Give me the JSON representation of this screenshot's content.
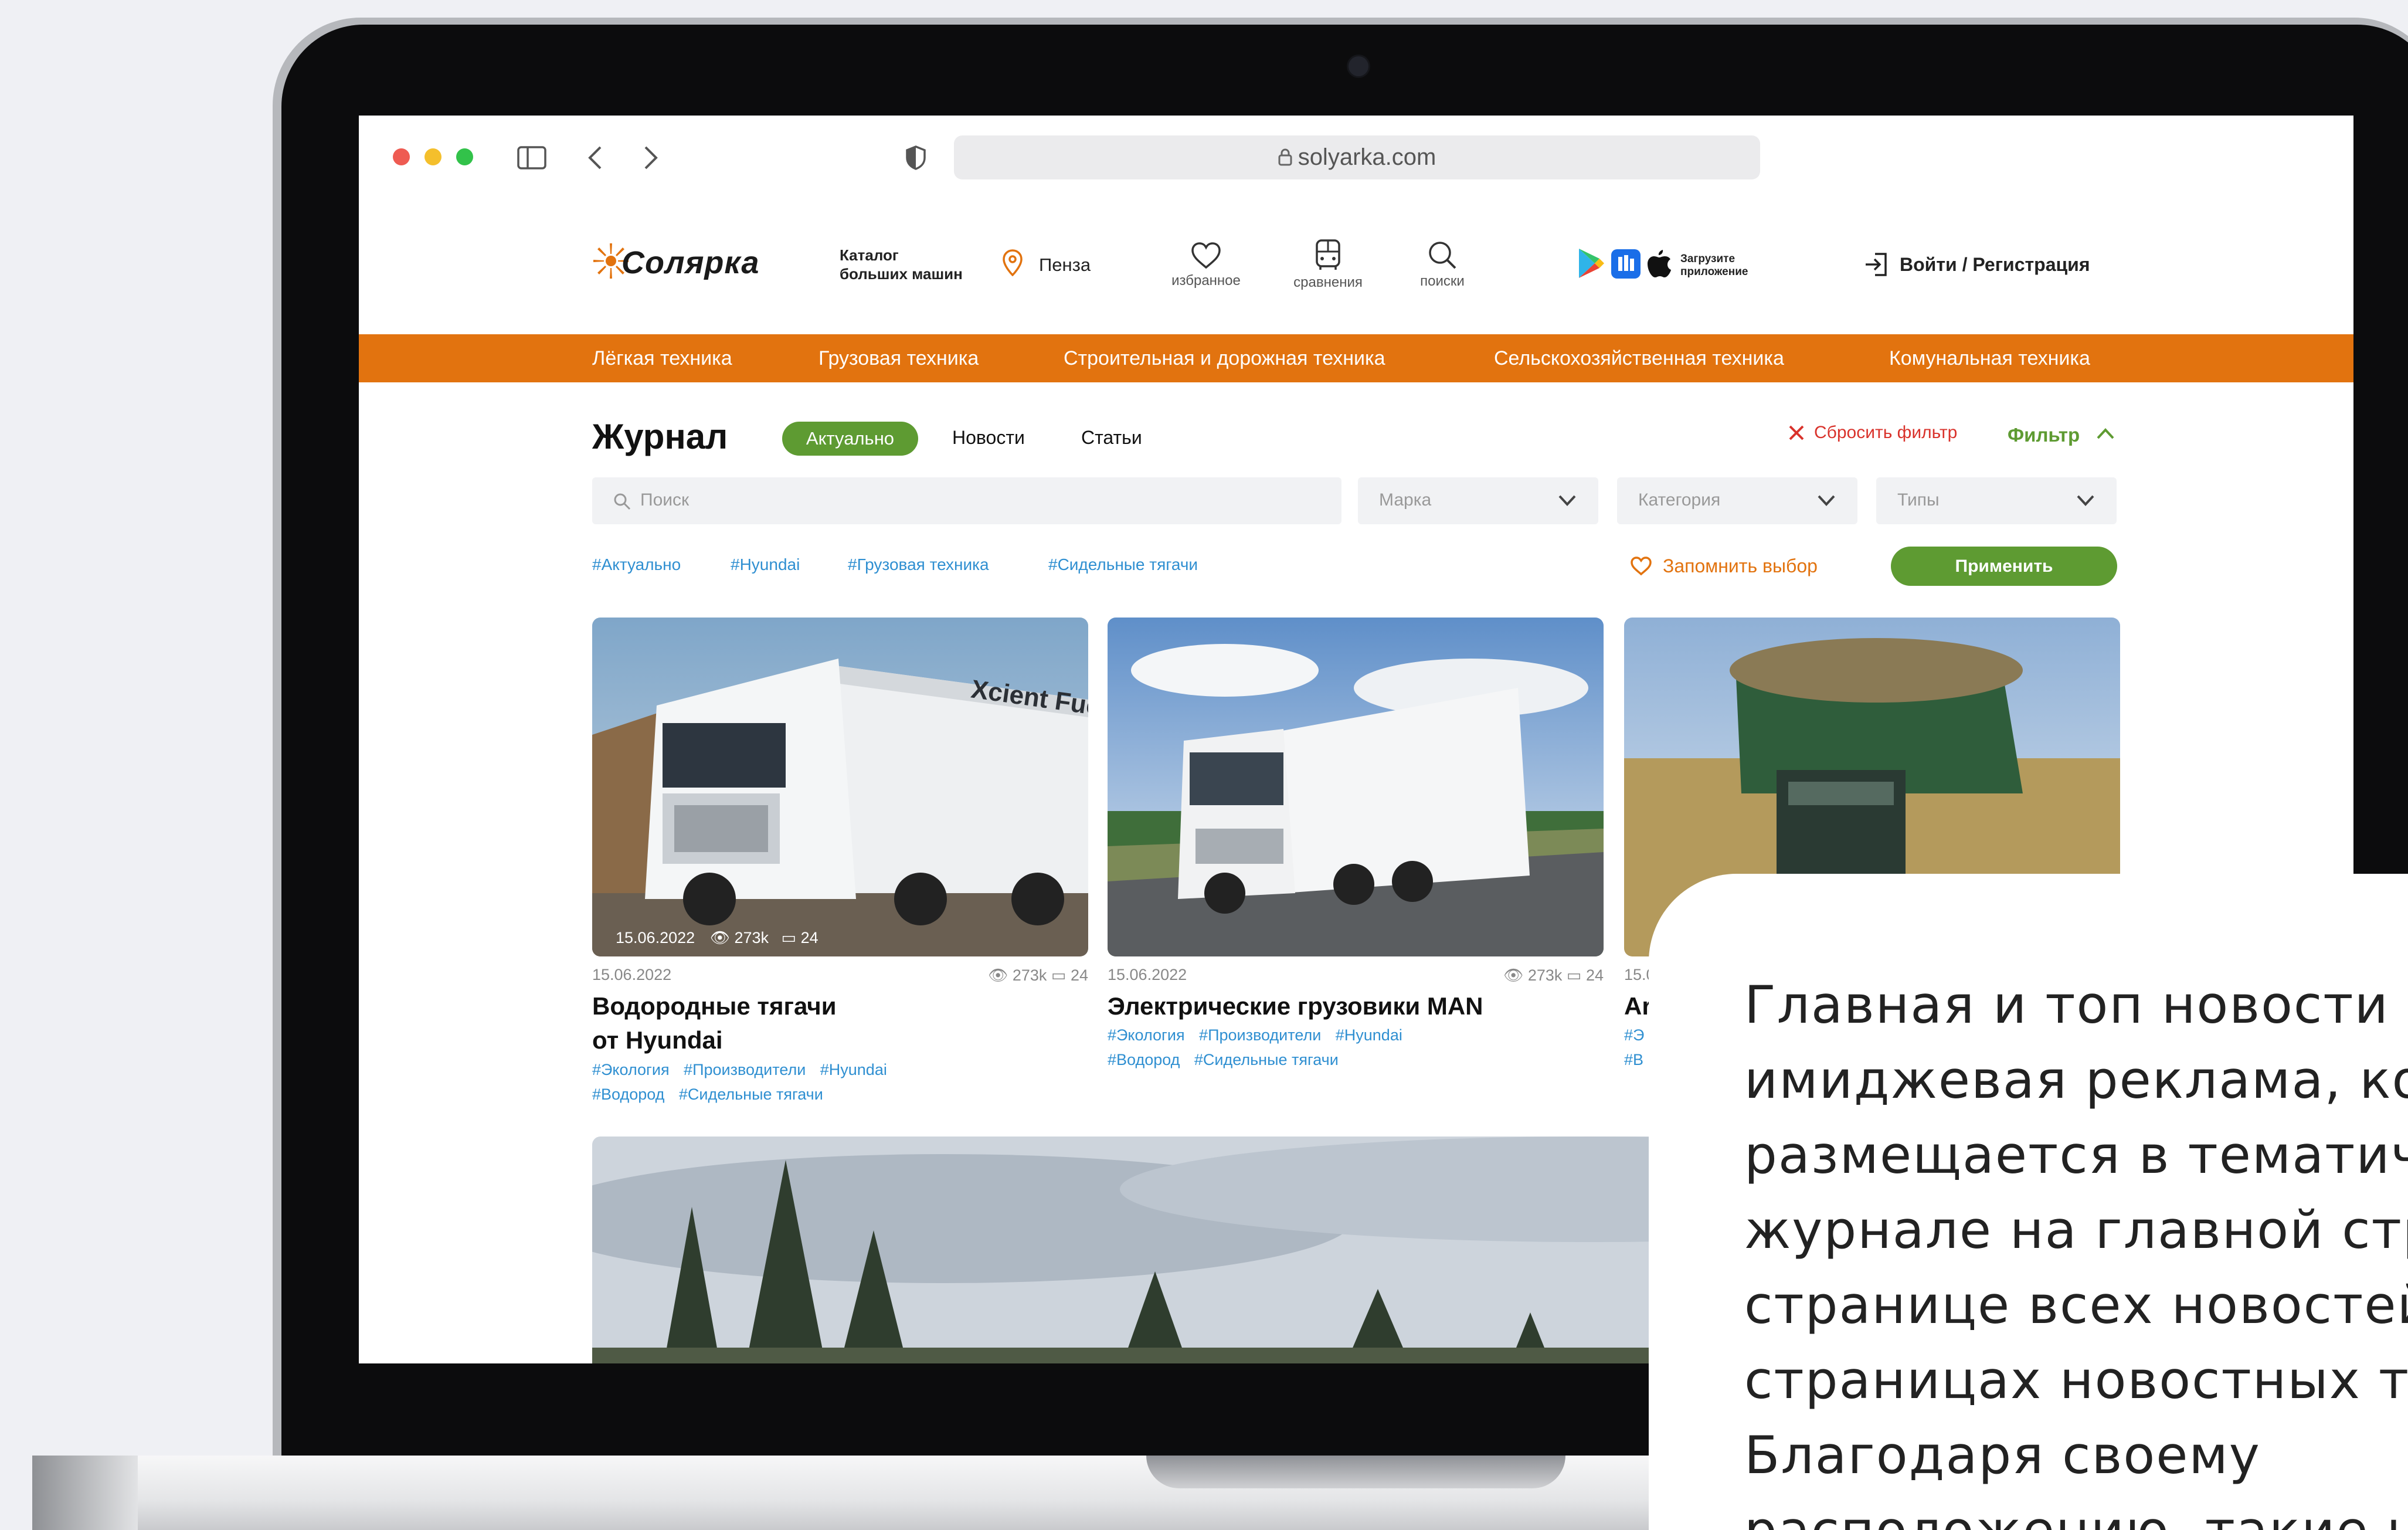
{
  "browser": {
    "url": "solyarka.com",
    "dot_colors": [
      "#ee5b52",
      "#f4bf2c",
      "#32c24a"
    ]
  },
  "header": {
    "logo_text": "Cолярка",
    "logo_tagline_1": "Каталог",
    "logo_tagline_2": "больших машин",
    "city": "Пенза",
    "icons": [
      {
        "label": "избранное",
        "icon": "heart-icon"
      },
      {
        "label": "сравнения",
        "icon": "compare-icon"
      },
      {
        "label": "поиски",
        "icon": "search-icon"
      }
    ],
    "app_promo_1": "Загрузите",
    "app_promo_2": "приложение",
    "login": "Войти / Регистрация"
  },
  "nav": {
    "items": [
      "Лёгкая техника",
      "Грузовая техника",
      "Строительная и дорожная техника",
      "Сельскохозяйственная техника",
      "Комунальная техника"
    ],
    "color": "#e2730f"
  },
  "journal": {
    "title": "Журнал",
    "tabs": [
      "Актуально",
      "Новости",
      "Статьи"
    ],
    "reset_filter": "Сбросить фильтр",
    "filter": "Фильтр",
    "search_placeholder": "Поиск",
    "selects": [
      "Марка",
      "Категория",
      "Типы"
    ],
    "tags": [
      "#Актуально",
      "#Hyundai",
      "#Грузовая техника",
      "#Сидельные тягачи"
    ],
    "remember": "Запомнить выбор",
    "apply": "Применить",
    "accent_green": "#5e9b32"
  },
  "cards": [
    {
      "date": "15.06.2022",
      "views": "273k",
      "comments": "24",
      "overlay_date": "15.06.2022",
      "overlay_views": "273k",
      "overlay_comments": "24",
      "image_text": "Xcient Fuel Cell",
      "title_1": "Водородные тягачи",
      "title_2": "от Hyundai",
      "tags_row1": [
        "#Экология",
        "#Производители",
        "#Hyundai"
      ],
      "tags_row2": [
        "#Водород",
        "#Сидельные тягачи"
      ]
    },
    {
      "date": "15.06.2022",
      "views": "273k",
      "comments": "24",
      "title_1": "Электрические грузовики MAN",
      "tags_row1": [
        "#Экология",
        "#Производители",
        "#Hyundai"
      ],
      "tags_row2": [
        "#Водород",
        "#Сидельные тягачи"
      ]
    },
    {
      "date": "15.0",
      "title_1": "Ar",
      "tags_row1": [
        "#Э"
      ],
      "tags_row2": [
        "#В"
      ]
    }
  ],
  "panel": {
    "lines": [
      "Главная и топ новости –",
      "имиджевая реклама, ко",
      "размещается в тематич",
      "журнале на главной стр",
      "странице всех новостей",
      "страницах новостных те",
      "Благодаря своему",
      "расположению, такие н"
    ]
  }
}
